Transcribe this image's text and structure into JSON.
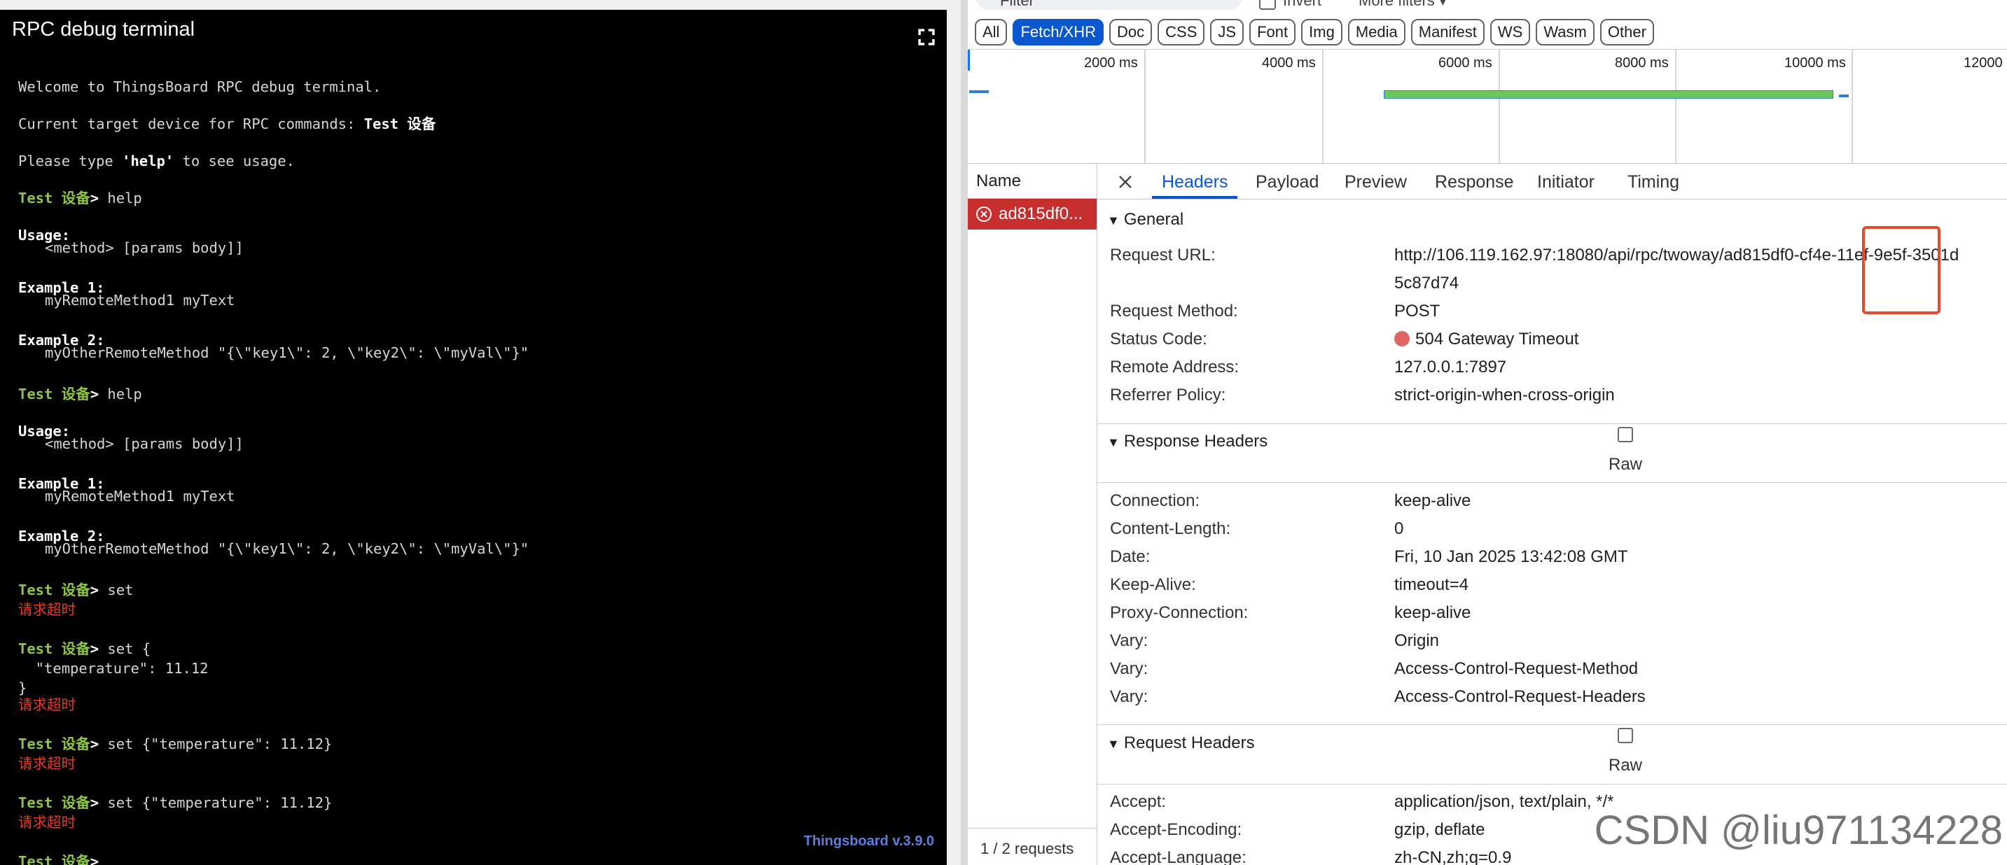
{
  "terminal": {
    "title": "RPC debug terminal",
    "welcome": "Welcome to ThingsBoard RPC debug terminal.",
    "target_prefix": "Current target device for RPC commands: ",
    "target_device": "Test 设备",
    "hint_prefix": "Please type ",
    "hint_keyword": "'help'",
    "hint_suffix": " to see usage.",
    "prompt": "Test 设备",
    "prompt_sep": "> ",
    "usage_label": "Usage:",
    "usage_text": "<method> [params body]]",
    "example1_label": "Example 1:",
    "example1_text": "myRemoteMethod1 myText",
    "example2_label": "Example 2:",
    "example2_text": "myOtherRemoteMethod \"{\\\"key1\\\": 2, \\\"key2\\\": \\\"myVal\\\"}\"",
    "cmd_help": "help",
    "cmd_set": "set",
    "cmd_set_open": "set {",
    "cmd_set_body": "  \"temperature\": 11.12",
    "cmd_set_close": "}",
    "cmd_set_inline": "set {\"temperature\": 11.12}",
    "timeout": "请求超时",
    "version": "Thingsboard v.3.9.0"
  },
  "devtools": {
    "filter_placeholder": "Filter",
    "invert_label": "Invert",
    "more_filters": "More filters ▾",
    "type_filters": [
      "All",
      "Fetch/XHR",
      "Doc",
      "CSS",
      "JS",
      "Font",
      "Img",
      "Media",
      "Manifest",
      "WS",
      "Wasm",
      "Other"
    ],
    "selected_filter": "Fetch/XHR",
    "timeline_ticks": [
      "2000 ms",
      "4000 ms",
      "6000 ms",
      "8000 ms",
      "10000 ms",
      "12000"
    ],
    "name_header": "Name",
    "request_name": "ad815df0...",
    "request_count": "1 / 2 requests",
    "tabs": [
      "Headers",
      "Payload",
      "Preview",
      "Response",
      "Initiator",
      "Timing"
    ],
    "active_tab": "Headers",
    "general": {
      "title": "General",
      "rows": [
        {
          "k": "Request URL:",
          "v": "http://106.119.162.97:18080/api/rpc/twoway/ad815df0-cf4e-11ef-9e5f-3501d",
          "v2": "5c87d74"
        },
        {
          "k": "Request Method:",
          "v": "POST"
        },
        {
          "k": "Status Code:",
          "v": "504 Gateway Timeout"
        },
        {
          "k": "Remote Address:",
          "v": "127.0.0.1:7897"
        },
        {
          "k": "Referrer Policy:",
          "v": "strict-origin-when-cross-origin"
        }
      ]
    },
    "response_headers": {
      "title": "Response Headers",
      "raw_label": "Raw",
      "rows": [
        {
          "k": "Connection:",
          "v": "keep-alive"
        },
        {
          "k": "Content-Length:",
          "v": "0"
        },
        {
          "k": "Date:",
          "v": "Fri, 10 Jan 2025 13:42:08 GMT"
        },
        {
          "k": "Keep-Alive:",
          "v": "timeout=4"
        },
        {
          "k": "Proxy-Connection:",
          "v": "keep-alive"
        },
        {
          "k": "Vary:",
          "v": "Origin"
        },
        {
          "k": "Vary:",
          "v": "Access-Control-Request-Method"
        },
        {
          "k": "Vary:",
          "v": "Access-Control-Request-Headers"
        }
      ]
    },
    "request_headers": {
      "title": "Request Headers",
      "raw_label": "Raw",
      "rows": [
        {
          "k": "Accept:",
          "v": "application/json, text/plain, */*"
        },
        {
          "k": "Accept-Encoding:",
          "v": "gzip, deflate"
        },
        {
          "k": "Accept-Language:",
          "v": "zh-CN,zh;q=0.9"
        }
      ]
    }
  },
  "watermark": "CSDN @liu971134228",
  "colors": {
    "prompt": "#8ec640",
    "error": "#e53b2b",
    "accent": "#0b57d0",
    "error_row": "#c72f2f"
  }
}
